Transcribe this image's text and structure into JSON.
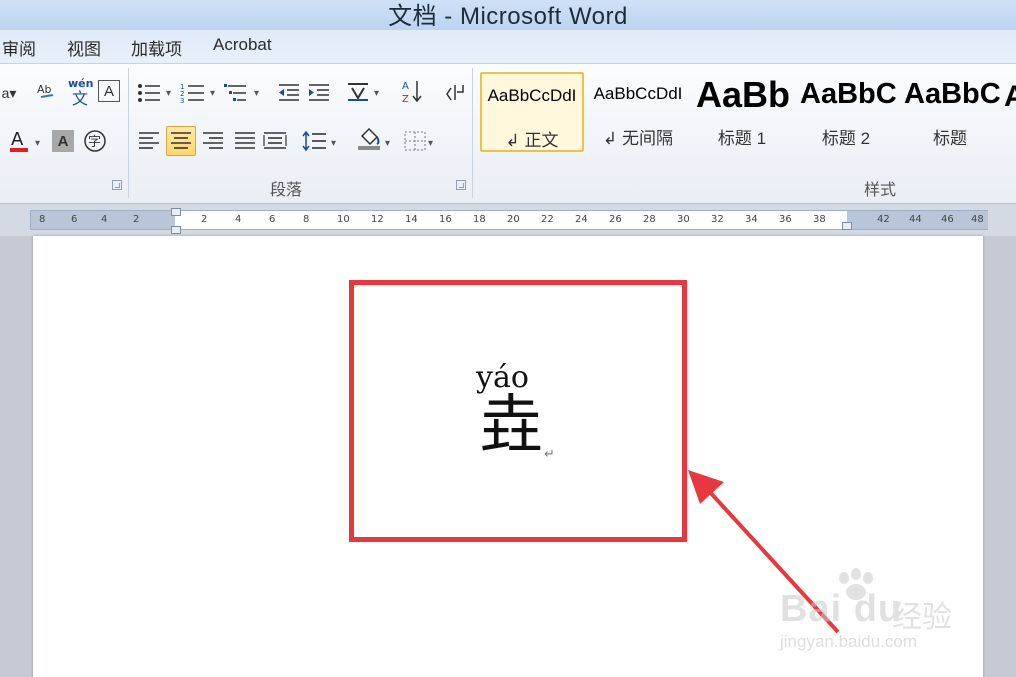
{
  "window": {
    "title": "文档 - Microsoft Word"
  },
  "menu": [
    "审阅",
    "视图",
    "加载项",
    "Acrobat"
  ],
  "ribbon": {
    "groups": {
      "paragraph": "段落",
      "styles": "样式"
    },
    "font_buttons": {
      "phonetic": "wén\n文",
      "font_color": "A",
      "char_shading": "A",
      "enclosed_char": "字"
    },
    "styles": [
      {
        "sample": "AaBbCcDdI",
        "name": "↲ 正文"
      },
      {
        "sample": "AaBbCcDdI",
        "name": "↲ 无间隔"
      },
      {
        "sample": "AaBb",
        "name": "标题 1"
      },
      {
        "sample": "AaBbC",
        "name": "标题 2"
      },
      {
        "sample": "AaBbC",
        "name": "标题"
      }
    ]
  },
  "ruler": {
    "labels": [
      "8",
      "6",
      "4",
      "2",
      "2",
      "4",
      "6",
      "8",
      "10",
      "12",
      "14",
      "16",
      "18",
      "20",
      "22",
      "24",
      "26",
      "28",
      "30",
      "32",
      "34",
      "36",
      "38",
      "42",
      "44",
      "46",
      "48"
    ]
  },
  "document": {
    "pinyin": "yáo",
    "character": "垚",
    "paragraph_mark": "↵"
  },
  "watermark": {
    "brand": "Bai du",
    "brand_cn": "经验",
    "url": "jingyan.baidu.com"
  },
  "colors": {
    "highlight_border": "#e8383f",
    "arrow": "#e8383f",
    "title_bar": "#cfe1f7",
    "selected_style": "#e9c34a"
  }
}
